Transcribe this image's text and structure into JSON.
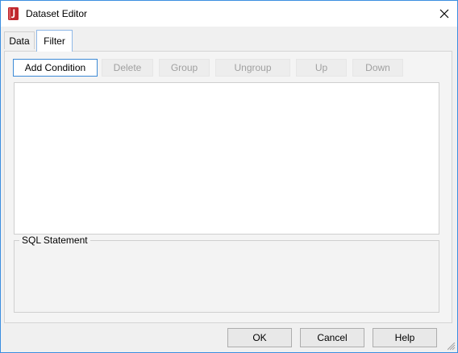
{
  "window": {
    "title": "Dataset Editor",
    "icon": "jreport-app-icon",
    "accent_color": "#3b8ee0",
    "close_icon": "close-icon"
  },
  "tabs": [
    {
      "label": "Data",
      "active": false
    },
    {
      "label": "Filter",
      "active": true
    }
  ],
  "toolbar": {
    "add_condition": "Add Condition",
    "delete": "Delete",
    "group": "Group",
    "ungroup": "Ungroup",
    "up": "Up",
    "down": "Down"
  },
  "conditions": [],
  "sql": {
    "legend": "SQL Statement",
    "text": ""
  },
  "footer": {
    "ok": "OK",
    "cancel": "Cancel",
    "help": "Help"
  }
}
